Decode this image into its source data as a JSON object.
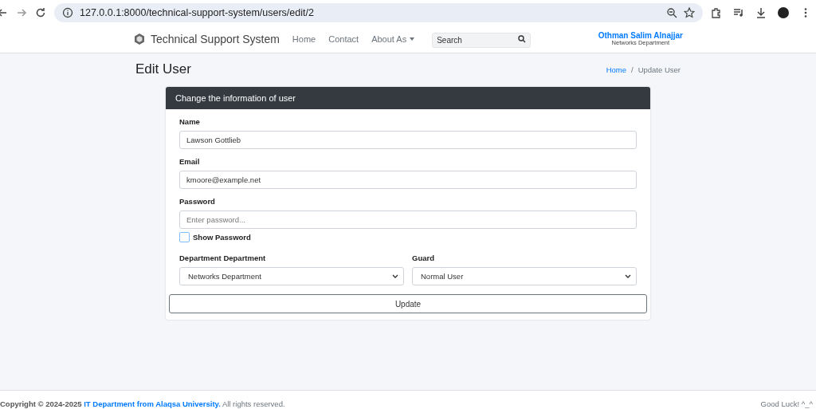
{
  "browser": {
    "url": "127.0.0.1:8000/technical-support-system/users/edit/2"
  },
  "navbar": {
    "brand": "Technical Support System",
    "links": [
      {
        "label": "Home",
        "kind": "link"
      },
      {
        "label": "Contact",
        "kind": "link"
      },
      {
        "label": "About As",
        "kind": "dropdown"
      }
    ],
    "search": {
      "placeholder": "Search"
    },
    "user": {
      "name": "Othman Salim Alnajjar",
      "department": "Networks Department"
    }
  },
  "page": {
    "title": "Edit User",
    "separator": "/",
    "breadcrumb": [
      {
        "label": "Home",
        "kind": "link"
      },
      {
        "label": "Update User",
        "kind": "current"
      }
    ]
  },
  "card": {
    "header": "Change the information of user",
    "fields": [
      {
        "kind": "text",
        "label": "Name",
        "value": "Lawson Gottlieb"
      },
      {
        "kind": "text",
        "label": "Email",
        "value": "kmoore@example.net"
      },
      {
        "kind": "password",
        "label": "Password",
        "placeholder": "Enter password..."
      }
    ],
    "show_password": {
      "label": "Show Password",
      "checked": false
    },
    "selects": [
      {
        "label": "Department Department",
        "value": "Networks Department"
      },
      {
        "label": "Guard",
        "value": "Normal User"
      }
    ],
    "button": "Update"
  },
  "footer": {
    "copyright": "**Copyright © 2024-2025**",
    "link": "IT Department from Alaqsa University.",
    "rest": "All rights reserved.",
    "right": "Good Luck! ^_^"
  }
}
